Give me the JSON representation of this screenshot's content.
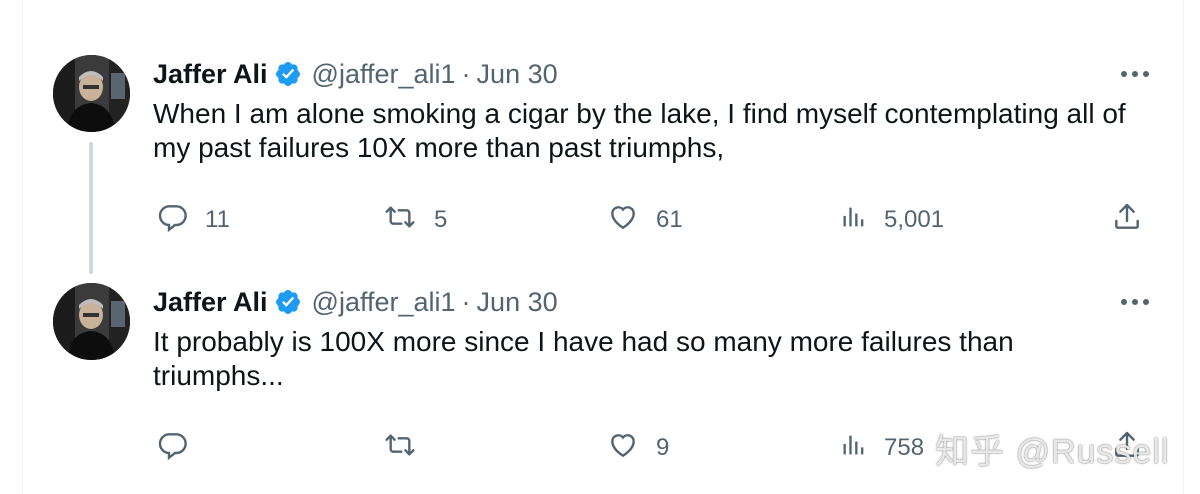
{
  "tweets": [
    {
      "name": "Jaffer Ali",
      "handle": "@jaffer_ali1",
      "separator": "·",
      "date": "Jun 30",
      "text": "When I am alone smoking a cigar by the lake, I find myself contemplating all of my past failures 10X more than past triumphs,",
      "replies": "11",
      "retweets": "5",
      "likes": "61",
      "views": "5,001"
    },
    {
      "name": "Jaffer Ali",
      "handle": "@jaffer_ali1",
      "separator": "·",
      "date": "Jun 30",
      "text": "It probably is 100X more since I have had so many more failures than triumphs...",
      "replies": "",
      "retweets": "",
      "likes": "9",
      "views": "758"
    }
  ],
  "icons": {
    "verified": "verified-badge-icon",
    "more": "more-icon",
    "reply": "reply-icon",
    "retweet": "retweet-icon",
    "like": "like-icon",
    "views": "views-icon",
    "share": "share-icon"
  },
  "colors": {
    "verified": "#1d9bf0",
    "text": "#0f1419",
    "secondary": "#536471",
    "thread_line": "#cfd9de"
  },
  "watermark": "知乎 @Russell"
}
